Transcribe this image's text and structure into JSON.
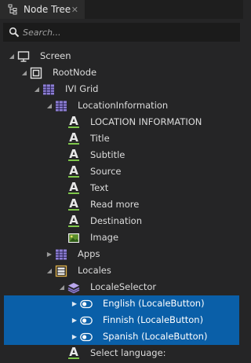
{
  "panel": {
    "tab_title": "Node Tree",
    "tab_icon": "node-tree-icon",
    "close_symbol": "✕"
  },
  "search": {
    "placeholder": "Search..."
  },
  "colors": {
    "background": "#252526",
    "selection": "#0a5fa8",
    "text_accent_underline": "#7ec64a",
    "grid_icon": "#8e7fd6"
  },
  "tree": {
    "nodes": [
      {
        "label": "Screen",
        "icon": "screen-icon",
        "expander": "expanded"
      },
      {
        "label": "RootNode",
        "icon": "root-node-icon",
        "expander": "expanded"
      },
      {
        "label": "IVI Grid",
        "icon": "grid-icon",
        "expander": "expanded"
      },
      {
        "label": "LocationInformation",
        "icon": "grid-icon",
        "expander": "expanded"
      },
      {
        "label": "LOCATION INFORMATION",
        "icon": "text-block-icon",
        "expander": "none"
      },
      {
        "label": "Title",
        "icon": "text-block-icon",
        "expander": "none"
      },
      {
        "label": "Subtitle",
        "icon": "text-block-icon",
        "expander": "none"
      },
      {
        "label": "Source",
        "icon": "text-block-icon",
        "expander": "none"
      },
      {
        "label": "Text",
        "icon": "text-block-icon",
        "expander": "none"
      },
      {
        "label": "Read more",
        "icon": "text-block-icon",
        "expander": "none"
      },
      {
        "label": "Destination",
        "icon": "text-block-icon",
        "expander": "none"
      },
      {
        "label": "Image",
        "icon": "image-icon",
        "expander": "none"
      },
      {
        "label": "Apps",
        "icon": "grid-icon",
        "expander": "collapsed"
      },
      {
        "label": "Locales",
        "icon": "stack-layout-icon",
        "expander": "expanded"
      },
      {
        "label": "LocaleSelector",
        "icon": "layers-icon",
        "expander": "expanded"
      },
      {
        "label": "English (LocaleButton)",
        "icon": "toggle-button-icon",
        "expander": "collapsed",
        "selected": true
      },
      {
        "label": "Finnish (LocaleButton)",
        "icon": "toggle-button-icon",
        "expander": "collapsed",
        "selected": true
      },
      {
        "label": "Spanish (LocaleButton)",
        "icon": "toggle-button-icon",
        "expander": "collapsed",
        "selected": true
      },
      {
        "label": "Select language:",
        "icon": "text-block-icon",
        "expander": "none"
      }
    ]
  }
}
